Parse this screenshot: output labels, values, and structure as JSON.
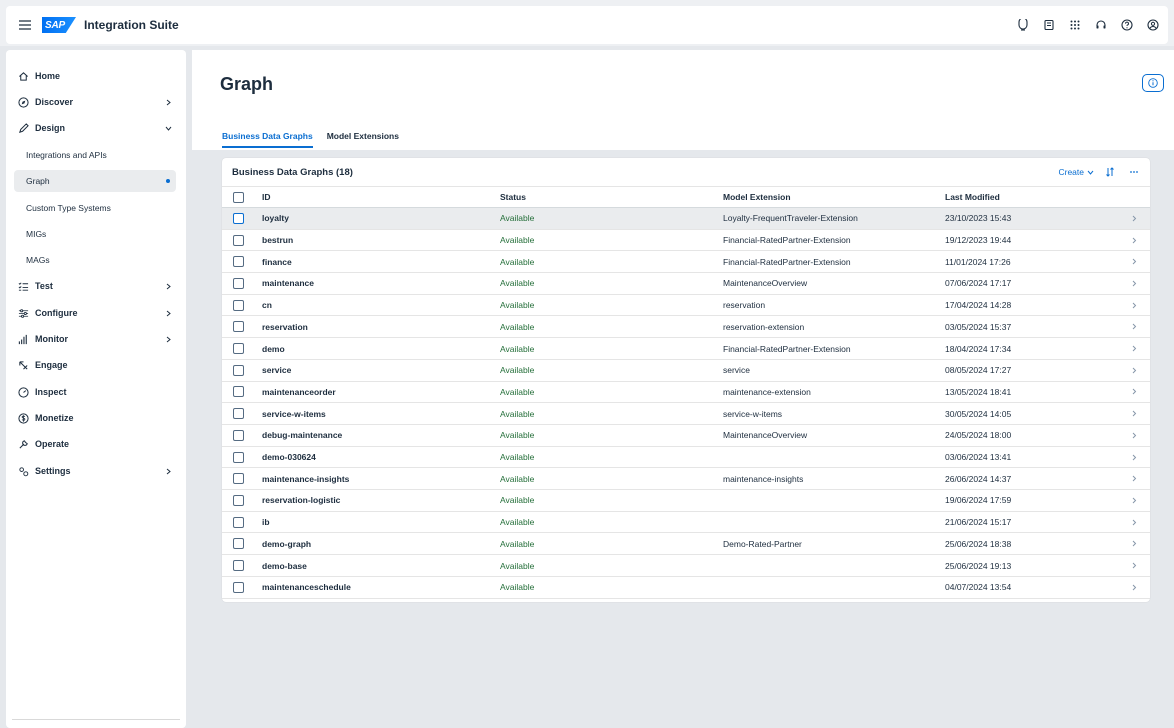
{
  "shell": {
    "logo_text": "SAP",
    "product": "Integration Suite",
    "actions": [
      {
        "icon": "joule-icon"
      },
      {
        "icon": "notifications-icon"
      },
      {
        "icon": "product-switch-icon"
      },
      {
        "icon": "headset-icon"
      },
      {
        "icon": "help-icon"
      },
      {
        "icon": "user-icon"
      }
    ]
  },
  "sidebar": {
    "items": [
      {
        "label": "Home",
        "icon": "home-icon"
      },
      {
        "label": "Discover",
        "icon": "compass-icon"
      },
      {
        "label": "Design",
        "icon": "pencil-icon"
      },
      {
        "label": "Test",
        "icon": "checklist-icon"
      },
      {
        "label": "Configure",
        "icon": "sliders-icon"
      },
      {
        "label": "Monitor",
        "icon": "bar-chart-icon"
      },
      {
        "label": "Engage",
        "icon": "engage-icon"
      },
      {
        "label": "Inspect",
        "icon": "gauge-icon"
      },
      {
        "label": "Monetize",
        "icon": "dollar-icon"
      },
      {
        "label": "Operate",
        "icon": "wrench-icon"
      },
      {
        "label": "Settings",
        "icon": "gears-icon"
      }
    ],
    "design_sub": [
      {
        "label": "Integrations and APIs"
      },
      {
        "label": "Graph",
        "selected": true
      },
      {
        "label": "Custom Type Systems"
      },
      {
        "label": "MIGs"
      },
      {
        "label": "MAGs"
      }
    ]
  },
  "page": {
    "title": "Graph",
    "tabs": [
      {
        "label": "Business Data Graphs",
        "active": true
      },
      {
        "label": "Model Extensions",
        "active": false
      }
    ]
  },
  "table": {
    "title": "Business Data Graphs (18)",
    "create_label": "Create",
    "columns": {
      "id": "ID",
      "status": "Status",
      "model": "Model Extension",
      "modified": "Last Modified"
    },
    "rows": [
      {
        "id": "loyalty",
        "status": "Available",
        "model": "Loyalty-FrequentTraveler-Extension",
        "modified": "23/10/2023 15:43"
      },
      {
        "id": "bestrun",
        "status": "Available",
        "model": "Financial-RatedPartner-Extension",
        "modified": "19/12/2023 19:44"
      },
      {
        "id": "finance",
        "status": "Available",
        "model": "Financial-RatedPartner-Extension",
        "modified": "11/01/2024 17:26"
      },
      {
        "id": "maintenance",
        "status": "Available",
        "model": "MaintenanceOverview",
        "modified": "07/06/2024 17:17"
      },
      {
        "id": "cn",
        "status": "Available",
        "model": "reservation",
        "modified": "17/04/2024 14:28"
      },
      {
        "id": "reservation",
        "status": "Available",
        "model": "reservation-extension",
        "modified": "03/05/2024 15:37"
      },
      {
        "id": "demo",
        "status": "Available",
        "model": "Financial-RatedPartner-Extension",
        "modified": "18/04/2024 17:34"
      },
      {
        "id": "service",
        "status": "Available",
        "model": "service",
        "modified": "08/05/2024 17:27"
      },
      {
        "id": "maintenanceorder",
        "status": "Available",
        "model": "maintenance-extension",
        "modified": "13/05/2024 18:41"
      },
      {
        "id": "service-w-items",
        "status": "Available",
        "model": "service-w-items",
        "modified": "30/05/2024 14:05"
      },
      {
        "id": "debug-maintenance",
        "status": "Available",
        "model": "MaintenanceOverview",
        "modified": "24/05/2024 18:00"
      },
      {
        "id": "demo-030624",
        "status": "Available",
        "model": "",
        "modified": "03/06/2024 13:41"
      },
      {
        "id": "maintenance-insights",
        "status": "Available",
        "model": "maintenance-insights",
        "modified": "26/06/2024 14:37"
      },
      {
        "id": "reservation-logistic",
        "status": "Available",
        "model": "",
        "modified": "19/06/2024 17:59"
      },
      {
        "id": "ib",
        "status": "Available",
        "model": "",
        "modified": "21/06/2024 15:17"
      },
      {
        "id": "demo-graph",
        "status": "Available",
        "model": "Demo-Rated-Partner",
        "modified": "25/06/2024 18:38"
      },
      {
        "id": "demo-base",
        "status": "Available",
        "model": "",
        "modified": "25/06/2024 19:13"
      },
      {
        "id": "maintenanceschedule",
        "status": "Available",
        "model": "",
        "modified": "04/07/2024 13:54"
      }
    ]
  },
  "colors": {
    "accent": "#0a6ed1",
    "status_positive": "#256f3a",
    "text": "#1d2d3e",
    "hover": "#eaecee"
  }
}
